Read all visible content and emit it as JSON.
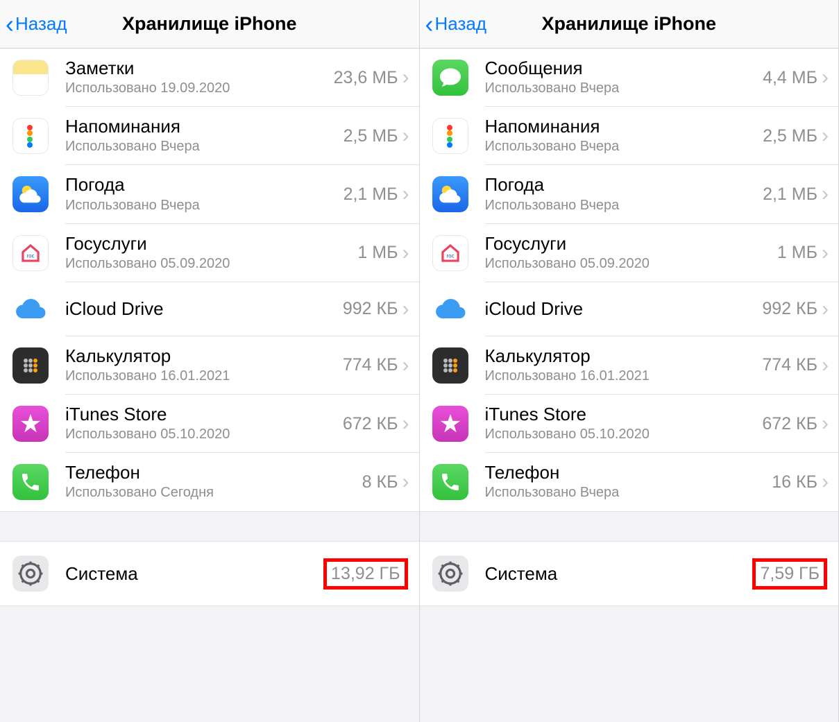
{
  "panes": [
    {
      "back_label": "Назад",
      "title": "Хранилище iPhone",
      "apps": [
        {
          "icon": "notes",
          "name": "Заметки",
          "sub": "Использовано 19.09.2020",
          "size": "23,6 МБ"
        },
        {
          "icon": "reminders",
          "name": "Напоминания",
          "sub": "Использовано Вчера",
          "size": "2,5 МБ"
        },
        {
          "icon": "weather",
          "name": "Погода",
          "sub": "Использовано Вчера",
          "size": "2,1 МБ"
        },
        {
          "icon": "gosuslugi",
          "name": "Госуслуги",
          "sub": "Использовано 05.09.2020",
          "size": "1 МБ"
        },
        {
          "icon": "icloud",
          "name": "iCloud Drive",
          "sub": "",
          "size": "992 КБ"
        },
        {
          "icon": "calculator",
          "name": "Калькулятор",
          "sub": "Использовано 16.01.2021",
          "size": "774 КБ"
        },
        {
          "icon": "itunes",
          "name": "iTunes Store",
          "sub": "Использовано 05.10.2020",
          "size": "672 КБ"
        },
        {
          "icon": "phone",
          "name": "Телефон",
          "sub": "Использовано Сегодня",
          "size": "8 КБ"
        }
      ],
      "system_label": "Система",
      "system_size": "13,92 ГБ"
    },
    {
      "back_label": "Назад",
      "title": "Хранилище iPhone",
      "apps": [
        {
          "icon": "messages",
          "name": "Сообщения",
          "sub": "Использовано Вчера",
          "size": "4,4 МБ"
        },
        {
          "icon": "reminders",
          "name": "Напоминания",
          "sub": "Использовано Вчера",
          "size": "2,5 МБ"
        },
        {
          "icon": "weather",
          "name": "Погода",
          "sub": "Использовано Вчера",
          "size": "2,1 МБ"
        },
        {
          "icon": "gosuslugi",
          "name": "Госуслуги",
          "sub": "Использовано 05.09.2020",
          "size": "1 МБ"
        },
        {
          "icon": "icloud",
          "name": "iCloud Drive",
          "sub": "",
          "size": "992 КБ"
        },
        {
          "icon": "calculator",
          "name": "Калькулятор",
          "sub": "Использовано 16.01.2021",
          "size": "774 КБ"
        },
        {
          "icon": "itunes",
          "name": "iTunes Store",
          "sub": "Использовано 05.10.2020",
          "size": "672 КБ"
        },
        {
          "icon": "phone",
          "name": "Телефон",
          "sub": "Использовано Вчера",
          "size": "16 КБ"
        }
      ],
      "system_label": "Система",
      "system_size": "7,59 ГБ"
    }
  ]
}
